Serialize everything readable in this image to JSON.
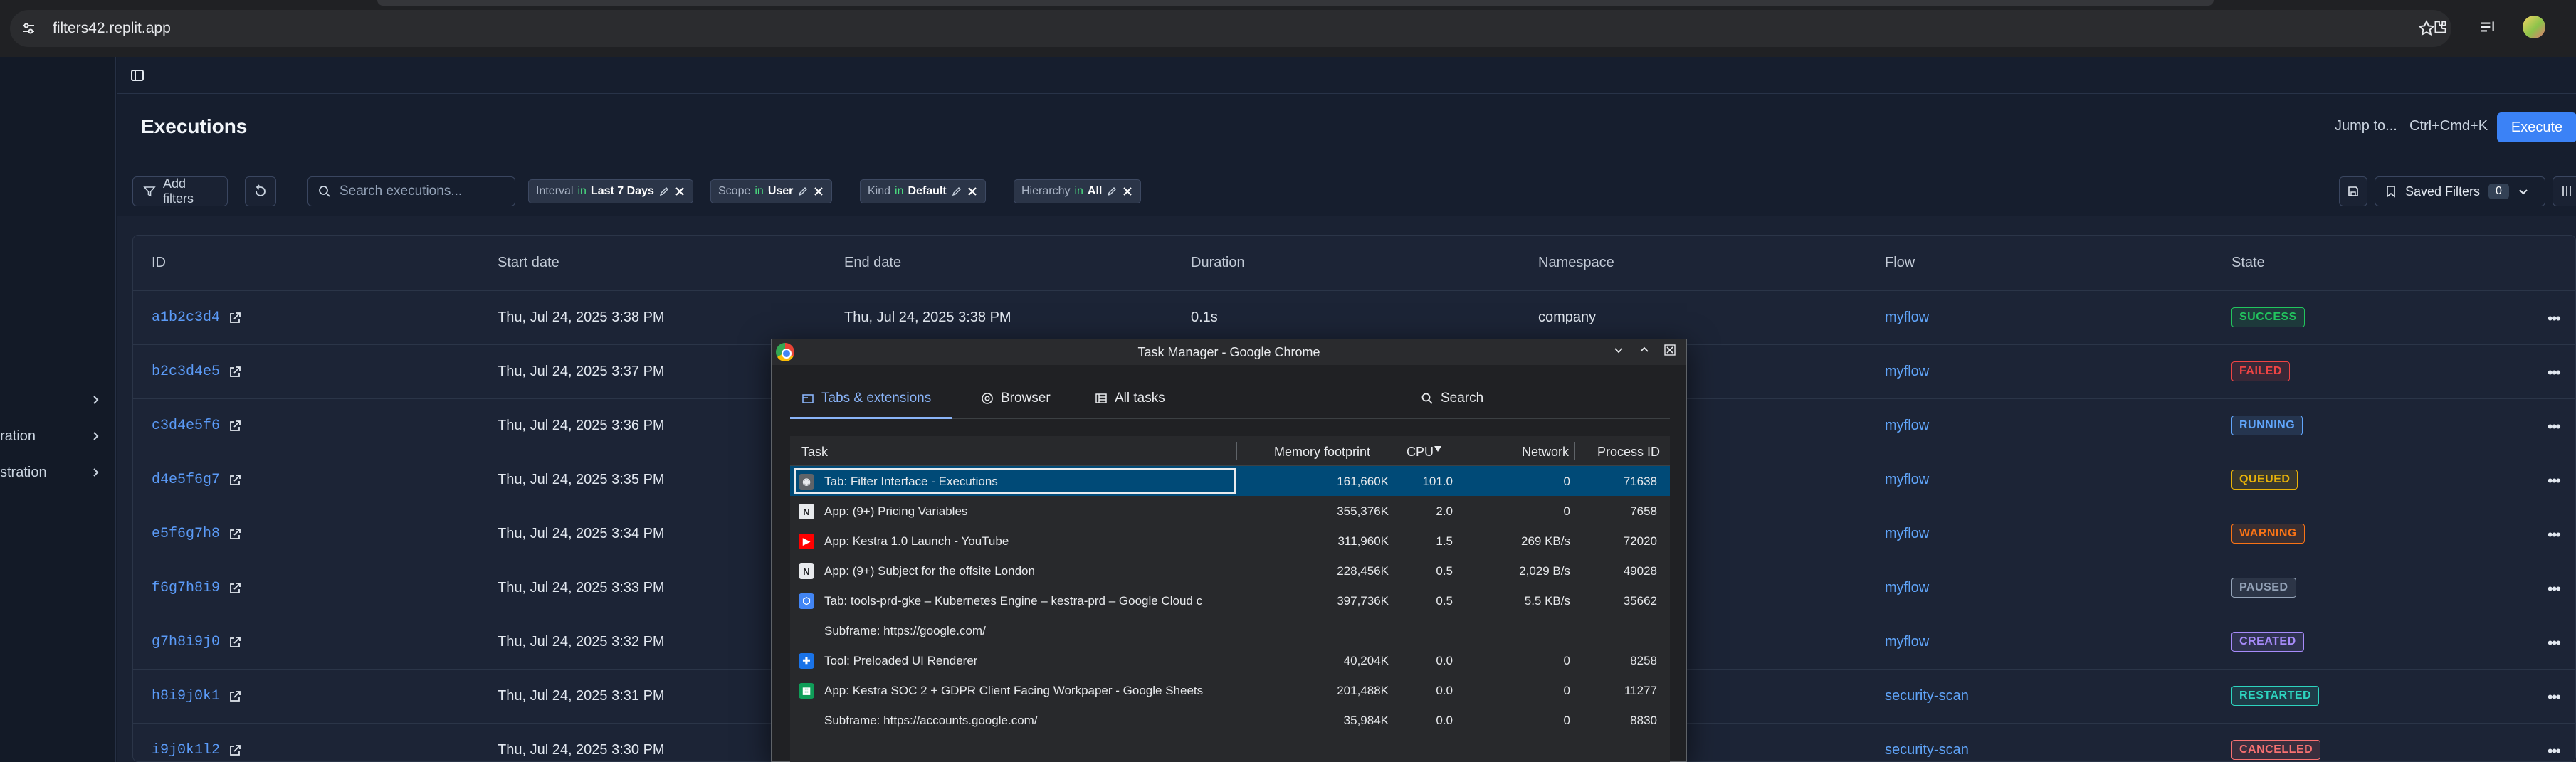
{
  "browser": {
    "url": "filters42.replit.app",
    "icons": [
      "tune-icon",
      "star-icon",
      "extensions-icon",
      "tab-search-icon",
      "profile-avatar"
    ]
  },
  "sidebar": {
    "items": [
      {
        "label": "",
        "icon": "chevron-right-icon"
      },
      {
        "label": "ration",
        "icon": "chevron-right-icon"
      },
      {
        "label": "stration",
        "icon": "chevron-right-icon"
      }
    ]
  },
  "header": {
    "title": "Executions",
    "jump_label": "Jump to...",
    "shortcut": "Ctrl+Cmd+K",
    "execute_label": "Execute"
  },
  "filters": {
    "add_label": "Add filters",
    "search_placeholder": "Search executions...",
    "chips": [
      {
        "field": "Interval",
        "op": "in",
        "value": "Last 7 Days"
      },
      {
        "field": "Scope",
        "op": "in",
        "value": "User"
      },
      {
        "field": "Kind",
        "op": "in",
        "value": "Default"
      },
      {
        "field": "Hierarchy",
        "op": "in",
        "value": "All"
      }
    ],
    "saved_label": "Saved Filters",
    "saved_count": "0"
  },
  "table": {
    "columns": [
      "ID",
      "Start date",
      "End date",
      "Duration",
      "Namespace",
      "Flow",
      "State"
    ],
    "rows": [
      {
        "id": "a1b2c3d4",
        "start": "Thu, Jul 24, 2025 3:38 PM",
        "end": "Thu, Jul 24, 2025 3:38 PM",
        "duration": "0.1s",
        "namespace": "company",
        "flow": "myflow",
        "state": "SUCCESS"
      },
      {
        "id": "b2c3d4e5",
        "start": "Thu, Jul 24, 2025 3:37 PM",
        "end": "",
        "duration": "",
        "namespace": "",
        "flow": "myflow",
        "state": "FAILED"
      },
      {
        "id": "c3d4e5f6",
        "start": "Thu, Jul 24, 2025 3:36 PM",
        "end": "",
        "duration": "",
        "namespace": "",
        "flow": "myflow",
        "state": "RUNNING"
      },
      {
        "id": "d4e5f6g7",
        "start": "Thu, Jul 24, 2025 3:35 PM",
        "end": "",
        "duration": "",
        "namespace": "",
        "flow": "myflow",
        "state": "QUEUED"
      },
      {
        "id": "e5f6g7h8",
        "start": "Thu, Jul 24, 2025 3:34 PM",
        "end": "",
        "duration": "",
        "namespace": "",
        "flow": "myflow",
        "state": "WARNING"
      },
      {
        "id": "f6g7h8i9",
        "start": "Thu, Jul 24, 2025 3:33 PM",
        "end": "",
        "duration": "",
        "namespace": "",
        "flow": "myflow",
        "state": "PAUSED"
      },
      {
        "id": "g7h8i9j0",
        "start": "Thu, Jul 24, 2025 3:32 PM",
        "end": "",
        "duration": "",
        "namespace": "",
        "flow": "myflow",
        "state": "CREATED"
      },
      {
        "id": "h8i9j0k1",
        "start": "Thu, Jul 24, 2025 3:31 PM",
        "end": "",
        "duration": "",
        "namespace": "",
        "flow": "security-scan",
        "state": "RESTARTED"
      },
      {
        "id": "i9j0k1l2",
        "start": "Thu, Jul 24, 2025 3:30 PM",
        "end": "",
        "duration": "",
        "namespace": "",
        "flow": "security-scan",
        "state": "CANCELLED"
      }
    ],
    "state_colors": {
      "SUCCESS": "#22c55e",
      "FAILED": "#ef4444",
      "RUNNING": "#60a5fa",
      "QUEUED": "#eab308",
      "WARNING": "#f97316",
      "PAUSED": "#94a3b8",
      "CREATED": "#a78bfa",
      "RESTARTED": "#2dd4bf",
      "CANCELLED": "#f87171"
    }
  },
  "task_manager": {
    "title": "Task Manager - Google Chrome",
    "tabs": [
      "Tabs & extensions",
      "Browser",
      "All tasks"
    ],
    "search_label": "Search",
    "columns": {
      "task": "Task",
      "memory": "Memory footprint",
      "cpu": "CPU",
      "network": "Network",
      "pid": "Process ID"
    },
    "rows": [
      {
        "icon": "globe",
        "task": "Tab: Filter Interface - Executions",
        "memory": "161,660K",
        "cpu": "101.0",
        "network": "0",
        "pid": "71638"
      },
      {
        "icon": "notion",
        "task": "App: (9+) Pricing Variables",
        "memory": "355,376K",
        "cpu": "2.0",
        "network": "0",
        "pid": "7658"
      },
      {
        "icon": "youtube",
        "task": "App: Kestra 1.0 Launch - YouTube",
        "memory": "311,960K",
        "cpu": "1.5",
        "network": "269 KB/s",
        "pid": "72020"
      },
      {
        "icon": "notion",
        "task": "App: (9+) Subject for the offsite London",
        "memory": "228,456K",
        "cpu": "0.5",
        "network": "2,029 B/s",
        "pid": "49028"
      },
      {
        "icon": "gke",
        "task": "Tab: tools-prd-gke – Kubernetes Engine – kestra-prd – Google Cloud c",
        "memory": "397,736K",
        "cpu": "0.5",
        "network": "5.5 KB/s",
        "pid": "35662"
      },
      {
        "icon": "",
        "task": "Subframe: https://google.com/",
        "memory": "",
        "cpu": "",
        "network": "",
        "pid": ""
      },
      {
        "icon": "puzzle",
        "task": "Tool: Preloaded UI Renderer",
        "memory": "40,204K",
        "cpu": "0.0",
        "network": "0",
        "pid": "8258"
      },
      {
        "icon": "sheets",
        "task": "App: Kestra SOC 2 + GDPR Client Facing Workpaper - Google Sheets",
        "memory": "201,488K",
        "cpu": "0.0",
        "network": "0",
        "pid": "11277"
      },
      {
        "icon": "",
        "task": "Subframe: https://accounts.google.com/",
        "memory": "35,984K",
        "cpu": "0.0",
        "network": "0",
        "pid": "8830"
      }
    ]
  }
}
